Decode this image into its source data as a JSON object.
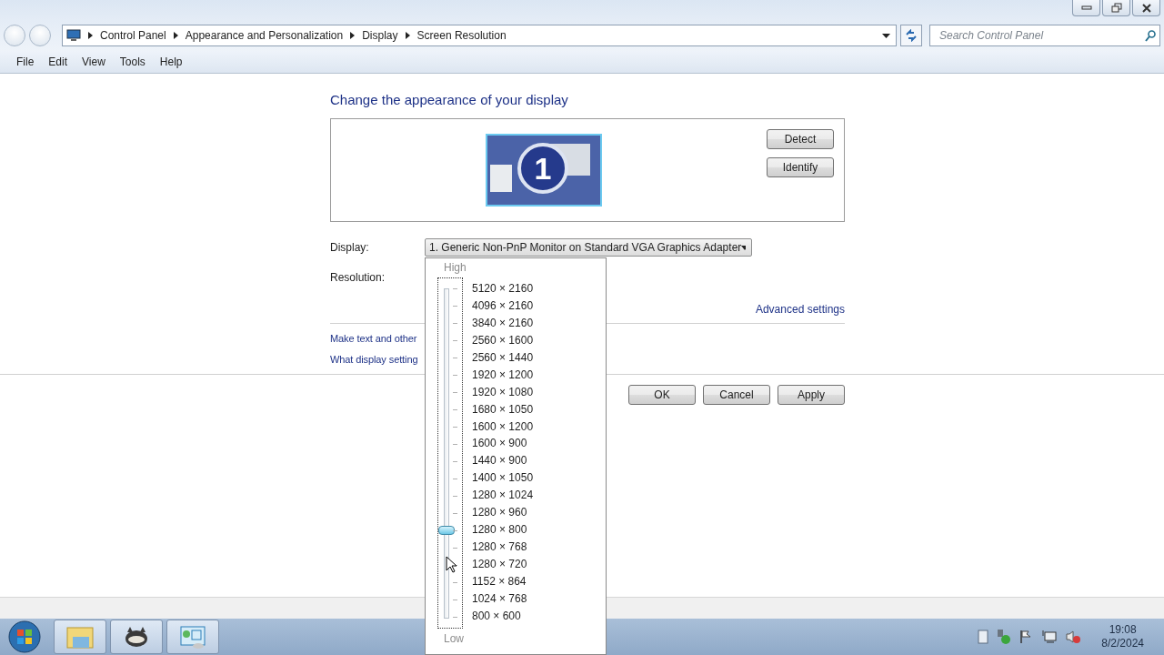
{
  "breadcrumb": [
    "Control Panel",
    "Appearance and Personalization",
    "Display",
    "Screen Resolution"
  ],
  "search": {
    "placeholder": "Search Control Panel"
  },
  "menu": [
    "File",
    "Edit",
    "View",
    "Tools",
    "Help"
  ],
  "heading": "Change the appearance of your display",
  "monitor_buttons": [
    "Detect",
    "Identify"
  ],
  "monitor_number": "1",
  "display": {
    "label": "Display:",
    "value": "1. Generic Non-PnP Monitor on Standard VGA Graphics Adapter"
  },
  "resolution": {
    "label": "Resolution:"
  },
  "advanced_link": "Advanced settings",
  "links": [
    "Make text and other",
    "What display setting"
  ],
  "buttons": [
    "OK",
    "Cancel",
    "Apply"
  ],
  "slider": {
    "top_label": "High",
    "bottom_label": "Low",
    "level": 0.263,
    "options": [
      "5120 × 2160",
      "4096 × 2160",
      "3840 × 2160",
      "2560 × 1600",
      "2560 × 1440",
      "1920 × 1200",
      "1920 × 1080",
      "1680 × 1050",
      "1600 × 1200",
      "1600 × 900",
      "1440 × 900",
      "1400 × 1050",
      "1280 × 1024",
      "1280 × 960",
      "1280 × 800",
      "1280 × 768",
      "1280 × 720",
      "1152 × 864",
      "1024 × 768",
      "800 × 600"
    ]
  },
  "clock": {
    "time": "19:08",
    "date": "8/2/2024"
  }
}
